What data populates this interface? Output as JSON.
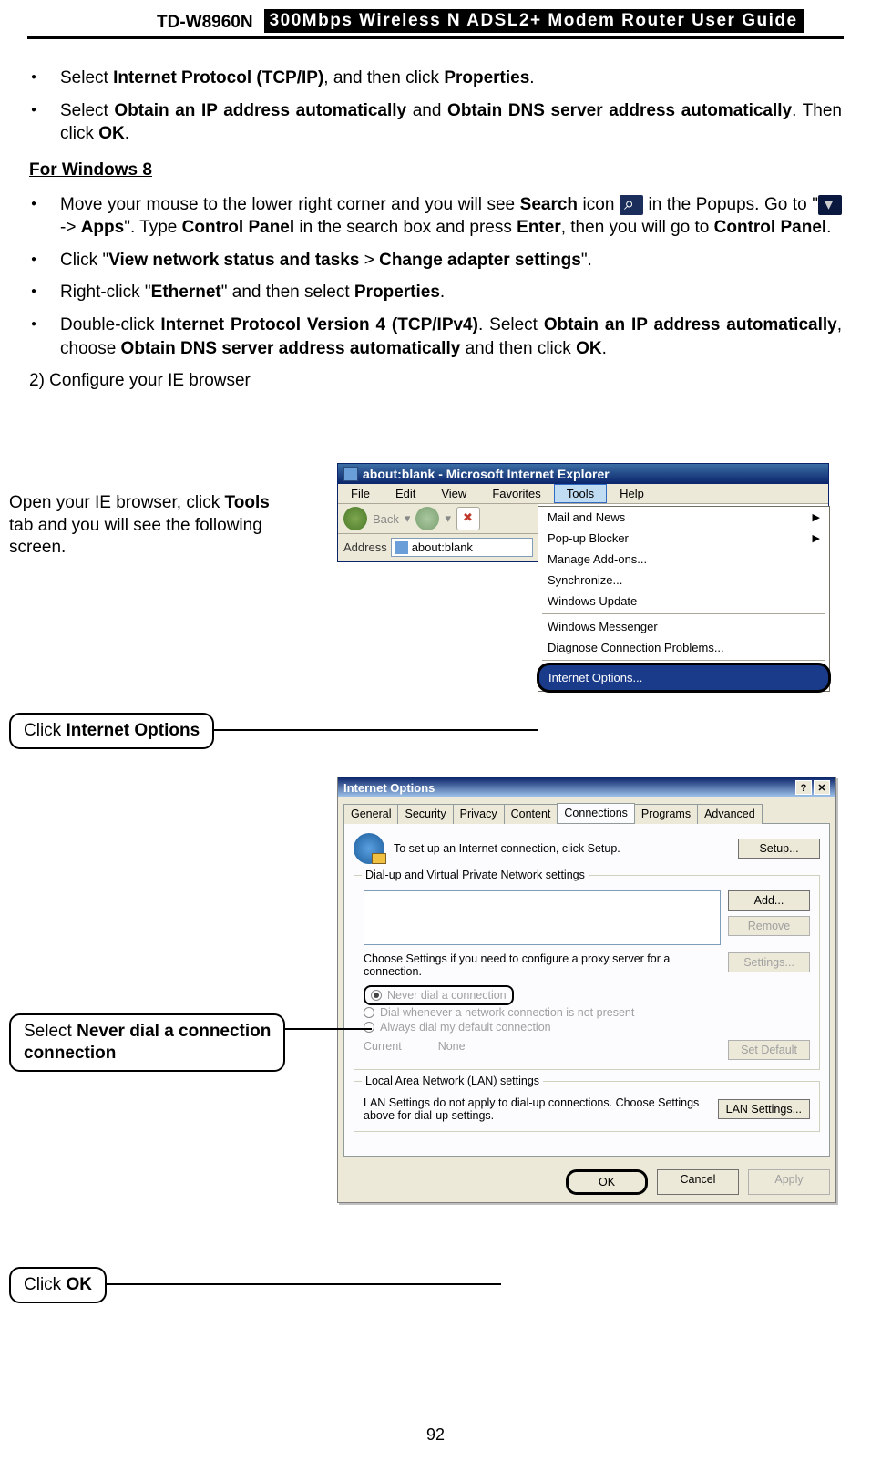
{
  "header": {
    "model": "TD-W8960N",
    "title": "300Mbps Wireless N ADSL2+ Modem Router User Guide"
  },
  "bullets_top": [
    {
      "pre": "Select ",
      "b1": "Internet Protocol (TCP/IP)",
      "mid": ", and then click ",
      "b2": "Properties",
      "post": "."
    },
    {
      "pre": "Select ",
      "b1": "Obtain an IP address automatically",
      "mid": " and ",
      "b2": "Obtain DNS server address automatically",
      "post": ". Then click ",
      "b3": "OK",
      "post2": "."
    }
  ],
  "windows8_heading": "For Windows 8",
  "bullets_w8": {
    "item1": {
      "t1": "Move your mouse to the lower right corner and you will see ",
      "b1": "Search",
      "t2": " icon ",
      "t3": " in the Popups. Go to \"",
      "t4": " -> ",
      "b2": "Apps",
      "t5": "\". Type ",
      "b3": "Control Panel",
      "t6": " in the search box and press ",
      "b4": "Enter",
      "t7": ", then you will go to ",
      "b5": "Control Panel",
      "t8": "."
    },
    "item2": {
      "t1": "Click \"",
      "b1": "View network status and tasks",
      "t2": " > ",
      "b2": "Change adapter settings",
      "t3": "\"."
    },
    "item3": {
      "t1": "Right-click \"",
      "b1": "Ethernet",
      "t2": "\" and then select ",
      "b2": "Properties",
      "t3": "."
    },
    "item4": {
      "t1": "Double-click ",
      "b1": "Internet Protocol Version 4 (TCP/IPv4)",
      "t2": ". Select ",
      "b2": "Obtain an IP address automatically",
      "t3": ", choose ",
      "b3": "Obtain DNS server address automatically",
      "t4": " and then click ",
      "b4": "OK",
      "t5": "."
    }
  },
  "step2_label": "2) Configure your IE browser",
  "side_text_1": {
    "t1": "Open your IE browser, click ",
    "b1": "Tools",
    "t2": " tab and you will see the following screen."
  },
  "callout1": {
    "t1": "Click ",
    "b1": "Internet Options"
  },
  "callout2": {
    "t1": "Select ",
    "b1": "Never dial a connection"
  },
  "callout3": {
    "t1": "Click ",
    "b1": "OK"
  },
  "ie": {
    "title": "about:blank - Microsoft Internet Explorer",
    "menus": [
      "File",
      "Edit",
      "View",
      "Favorites",
      "Tools",
      "Help"
    ],
    "back_label": "Back",
    "address_label": "Address",
    "address_value": "about:blank",
    "dropdown": [
      {
        "label": "Mail and News",
        "arrow": true
      },
      {
        "label": "Pop-up Blocker",
        "arrow": true
      },
      {
        "label": "Manage Add-ons..."
      },
      {
        "label": "Synchronize..."
      },
      {
        "label": "Windows Update"
      },
      {
        "sep": true
      },
      {
        "label": "Windows Messenger"
      },
      {
        "label": "Diagnose Connection Problems..."
      },
      {
        "sep": true
      },
      {
        "label": "Internet Options...",
        "highlight": true
      }
    ]
  },
  "io": {
    "title": "Internet Options",
    "tabs": [
      "General",
      "Security",
      "Privacy",
      "Content",
      "Connections",
      "Programs",
      "Advanced"
    ],
    "active_tab": 4,
    "setup_text": "To set up an Internet connection, click Setup.",
    "btn_setup": "Setup...",
    "group1_legend": "Dial-up and Virtual Private Network settings",
    "btn_add": "Add...",
    "btn_remove": "Remove",
    "proxy_text": "Choose Settings if you need to configure a proxy server for a connection.",
    "btn_settings": "Settings...",
    "radio1": "Never dial a connection",
    "radio2": "Dial whenever a network connection is not present",
    "radio3": "Always dial my default connection",
    "current_label": "Current",
    "current_value": "None",
    "btn_setdefault": "Set Default",
    "group2_legend": "Local Area Network (LAN) settings",
    "lan_text": "LAN Settings do not apply to dial-up connections. Choose Settings above for dial-up settings.",
    "btn_lan": "LAN Settings...",
    "btn_ok": "OK",
    "btn_cancel": "Cancel",
    "btn_apply": "Apply"
  },
  "page_number": "92"
}
